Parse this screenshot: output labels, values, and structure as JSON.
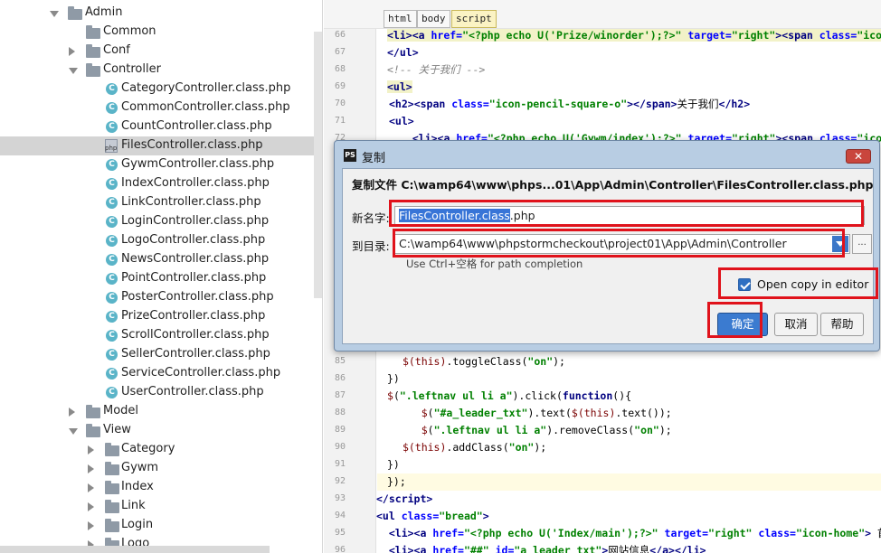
{
  "tree": {
    "items": [
      {
        "label": "Admin",
        "depth": 1,
        "kind": "folder",
        "expanded": true
      },
      {
        "label": "Common",
        "depth": 2,
        "kind": "folder"
      },
      {
        "label": "Conf",
        "depth": 2,
        "kind": "folder",
        "collapsed": true
      },
      {
        "label": "Controller",
        "depth": 2,
        "kind": "folder",
        "expanded": true
      },
      {
        "label": "CategoryController.class.php",
        "depth": 3,
        "kind": "class"
      },
      {
        "label": "CommonController.class.php",
        "depth": 3,
        "kind": "class"
      },
      {
        "label": "CountController.class.php",
        "depth": 3,
        "kind": "class"
      },
      {
        "label": "FilesController.class.php",
        "depth": 3,
        "kind": "php",
        "selected": true
      },
      {
        "label": "GywmController.class.php",
        "depth": 3,
        "kind": "class"
      },
      {
        "label": "IndexController.class.php",
        "depth": 3,
        "kind": "class"
      },
      {
        "label": "LinkController.class.php",
        "depth": 3,
        "kind": "class"
      },
      {
        "label": "LoginController.class.php",
        "depth": 3,
        "kind": "class"
      },
      {
        "label": "LogoController.class.php",
        "depth": 3,
        "kind": "class"
      },
      {
        "label": "NewsController.class.php",
        "depth": 3,
        "kind": "class"
      },
      {
        "label": "PointController.class.php",
        "depth": 3,
        "kind": "class"
      },
      {
        "label": "PosterController.class.php",
        "depth": 3,
        "kind": "class"
      },
      {
        "label": "PrizeController.class.php",
        "depth": 3,
        "kind": "class"
      },
      {
        "label": "ScrollController.class.php",
        "depth": 3,
        "kind": "class"
      },
      {
        "label": "SellerController.class.php",
        "depth": 3,
        "kind": "class"
      },
      {
        "label": "ServiceController.class.php",
        "depth": 3,
        "kind": "class"
      },
      {
        "label": "UserController.class.php",
        "depth": 3,
        "kind": "class"
      },
      {
        "label": "Model",
        "depth": 2,
        "kind": "folder",
        "collapsed": true
      },
      {
        "label": "View",
        "depth": 2,
        "kind": "folder",
        "expanded": true
      },
      {
        "label": "Category",
        "depth": 3,
        "kind": "folder",
        "collapsed": true
      },
      {
        "label": "Gywm",
        "depth": 3,
        "kind": "folder",
        "collapsed": true
      },
      {
        "label": "Index",
        "depth": 3,
        "kind": "folder",
        "collapsed": true
      },
      {
        "label": "Link",
        "depth": 3,
        "kind": "folder",
        "collapsed": true
      },
      {
        "label": "Login",
        "depth": 3,
        "kind": "folder",
        "collapsed": true
      },
      {
        "label": "Logo",
        "depth": 3,
        "kind": "folder",
        "collapsed": true
      }
    ]
  },
  "editor": {
    "breadcrumbs": [
      "html",
      "body",
      "script"
    ],
    "lines": [
      {
        "n": "66",
        "html": "<span class='tagbg'><span class='t'>&lt;li&gt;&lt;a </span><span class='a'>href=</span><span class='s'>\"&lt;?php echo U('Prize/winorder');?&gt;\"</span> <span class='a'>target=</span><span class='s'>\"right\"</span><span class='t'>&gt;&lt;span </span><span class='a'>class=</span><span class='s'>\"ico</span></span>"
      },
      {
        "n": "67",
        "html": "<span class='t'>&lt;/ul&gt;</span>"
      },
      {
        "n": "68",
        "html": "<span class='c'>&lt;!-- 关于我们 --&gt;</span>"
      },
      {
        "n": "69",
        "html": "<span class='t tagbg'>&lt;ul&gt;</span>"
      },
      {
        "n": "70",
        "html": "<span class='t'>&lt;h2&gt;&lt;span </span><span class='a'>class=</span><span class='s'>\"icon-pencil-square-o\"</span><span class='t'>&gt;&lt;/span&gt;</span>关于我们<span class='t'>&lt;/h2&gt;</span>"
      },
      {
        "n": "71",
        "html": "<span class='t'>&lt;ul&gt;</span>"
      },
      {
        "n": "72",
        "html": "  <span class='t'>&lt;li&gt;&lt;a </span><span class='a'>href=</span><span class='s'>\"&lt;?php echo U('Gywm/index');?&gt;\"</span> <span class='a'>target=</span><span class='s'>\"right\"</span><span class='t'>&gt;&lt;span </span><span class='a'>class=</span><span class='s'>\"icon-</span>"
      },
      {
        "n": "85",
        "html": " <span class='fn'>$(this)</span>.toggleClass(<span class='s'>\"on\"</span>);"
      },
      {
        "n": "86",
        "html": "})"
      },
      {
        "n": "87",
        "html": "<span class='fn'>$</span>(<span class='s'>\".leftnav ul li a\"</span>).click(<span class='kw'>function</span>(){"
      },
      {
        "n": "88",
        "html": "    <span class='fn'>$</span>(<span class='s'>\"#a_leader_txt\"</span>).text(<span class='fn'>$(this)</span>.text());"
      },
      {
        "n": "89",
        "html": "    <span class='fn'>$</span>(<span class='s'>\".leftnav ul li a\"</span>).removeClass(<span class='s'>\"on\"</span>);"
      },
      {
        "n": "90",
        "html": " <span class='fn'>$(this)</span>.addClass(<span class='s'>\"on\"</span>);"
      },
      {
        "n": "91",
        "html": "})"
      },
      {
        "n": "92",
        "html": "});"
      },
      {
        "n": "93",
        "html": "<span class='t'>&lt;/script&gt;</span>"
      },
      {
        "n": "94",
        "html": "<span class='t'>&lt;ul </span><span class='a'>class=</span><span class='s'>\"bread\"</span><span class='t'>&gt;</span>"
      },
      {
        "n": "95",
        "html": "  <span class='t'>&lt;li&gt;&lt;a </span><span class='a'>href=</span><span class='s'>\"&lt;?php echo U('Index/main');?&gt;\"</span> <span class='a'>target=</span><span class='s'>\"right\"</span> <span class='a'>class=</span><span class='s'>\"icon-home\"</span><span class='t'>&gt;</span> 首"
      },
      {
        "n": "96",
        "html": "  <span class='t'>&lt;li&gt;&lt;a </span><span class='a'>href=</span><span class='s'>\"##\"</span> <span class='a'>id=</span><span class='s'>\"a_leader_txt\"</span><span class='t'>&gt;</span>网站信息<span class='t'>&lt;/a&gt;&lt;/li&gt;</span>"
      }
    ]
  },
  "dialog": {
    "title": "复制",
    "logo": "PS",
    "close_label": "✕",
    "heading": "复制文件 C:\\wamp64\\www\\phps...01\\App\\Admin\\Controller\\FilesController.class.php",
    "new_name_label": "新名字:",
    "new_name_selected": "FilesController.class",
    "new_name_rest": ".php",
    "target_dir_label": "到目录:",
    "target_dir_value": "C:\\wamp64\\www\\phpstormcheckout\\project01\\App\\Admin\\Controller",
    "browse_label": "...",
    "hint": "Use Ctrl+空格 for path completion",
    "open_copy_label": "Open copy in editor",
    "open_copy_checked": true,
    "ok_label": "确定",
    "cancel_label": "取消",
    "help_label": "帮助"
  },
  "colors": {
    "annotation": "#e0121b",
    "selection": "#3875d7",
    "dialog_frame": "#b8cde3"
  }
}
